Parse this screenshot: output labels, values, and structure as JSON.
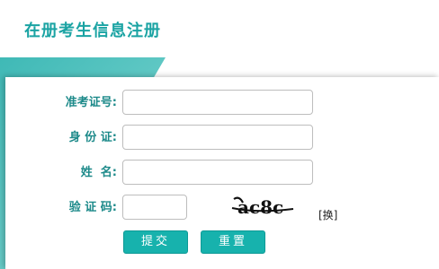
{
  "page": {
    "title": "在册考生信息注册"
  },
  "form": {
    "exam_id": {
      "label": "准考证号:",
      "value": ""
    },
    "id_card": {
      "label": "身 份 证:",
      "value": ""
    },
    "name": {
      "label": "姓  名:",
      "value": ""
    },
    "captcha": {
      "label": "验 证 码:",
      "value": "",
      "image_text": "ac8c",
      "swap_label": "[换]"
    }
  },
  "buttons": {
    "submit_label": "提交",
    "reset_label": "重置"
  },
  "colors": {
    "accent": "#17b2ad",
    "label": "#1d8a8a",
    "title": "#1aa3a3"
  }
}
